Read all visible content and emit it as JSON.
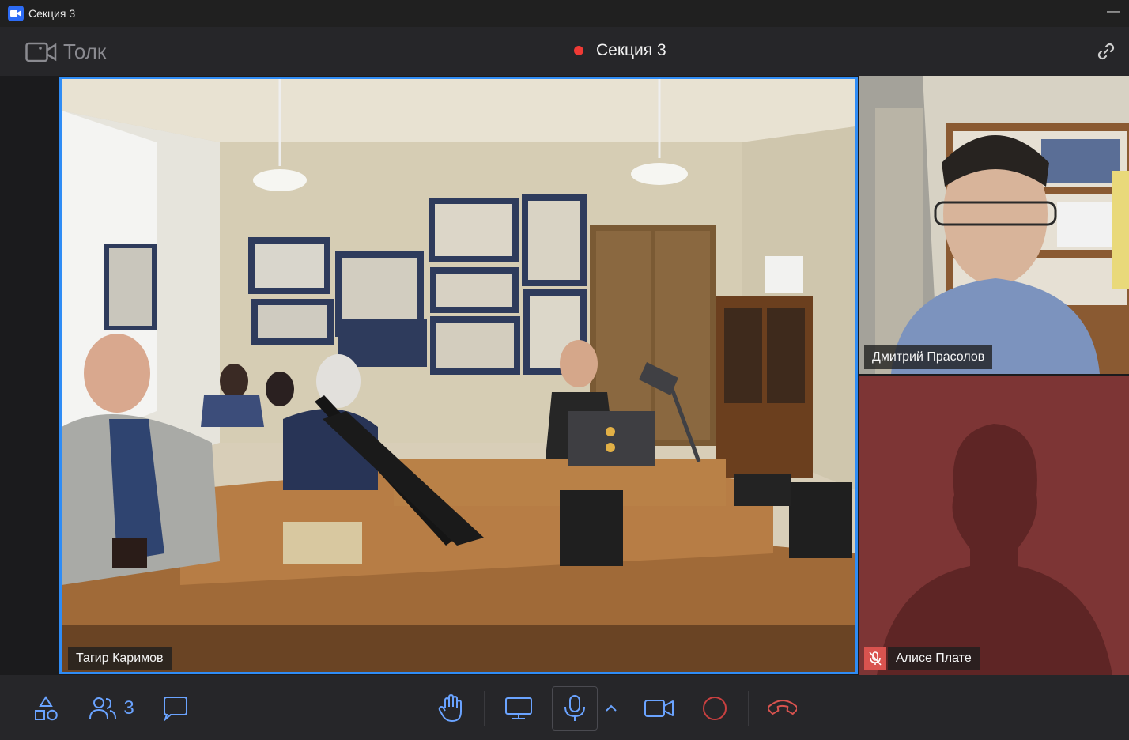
{
  "window": {
    "title": "Секция 3"
  },
  "header": {
    "brand": "Толк",
    "meeting_title": "Секция 3",
    "recording_color": "#f03a35"
  },
  "participants": {
    "main": {
      "name": "Тагир Каримов",
      "active_speaker_color": "#2f8cf5"
    },
    "side": [
      {
        "name": "Дмитрий Прасолов"
      },
      {
        "name": "Алисе Плате",
        "muted": true,
        "avatar_bg": "#7d3535"
      }
    ]
  },
  "toolbar": {
    "participants_count": "3",
    "accent": "#6aa3ff",
    "record_color": "#c94040",
    "leave_color": "#d9534f",
    "icons": [
      "shapes-icon",
      "participants-icon",
      "chat-icon",
      "raise-hand-icon",
      "screen-share-icon",
      "microphone-icon",
      "chevron-up-icon",
      "camera-icon",
      "record-icon",
      "leave-call-icon"
    ]
  }
}
